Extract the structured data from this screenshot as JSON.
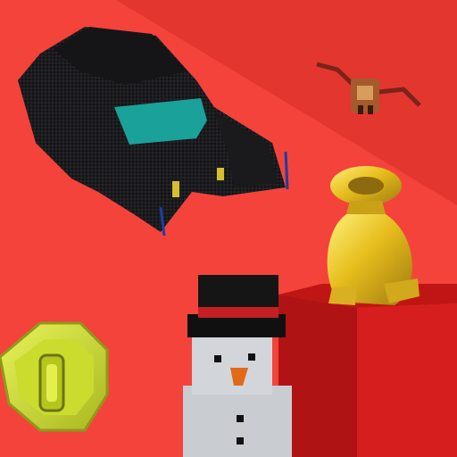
{
  "scene": {
    "items": [
      {
        "name": "armored-truck",
        "type": "vehicle"
      },
      {
        "name": "winged-creature",
        "type": "critter"
      },
      {
        "name": "gold-sack",
        "type": "treasure"
      },
      {
        "name": "snowman",
        "type": "character"
      },
      {
        "name": "coin",
        "type": "currency"
      },
      {
        "name": "red-cube",
        "type": "pedestal"
      }
    ]
  },
  "colors": {
    "background_light": "#f5403a",
    "background_dark": "#e23630",
    "truck_body": "#1c1c1e",
    "truck_windshield": "#1aa19a",
    "truck_headlight": "#d4c02c",
    "gold": "#e6bd1c",
    "gold_dark": "#a37f12",
    "coin_outer": "#c6d62a",
    "coin_inner": "#d9ea3b",
    "snow_white": "#cfd3d8",
    "hat_black": "#121212",
    "hat_band": "#c41f22",
    "carrot": "#e06a1a",
    "cube_red": "#d71e1e",
    "cube_dark": "#9a1212"
  }
}
